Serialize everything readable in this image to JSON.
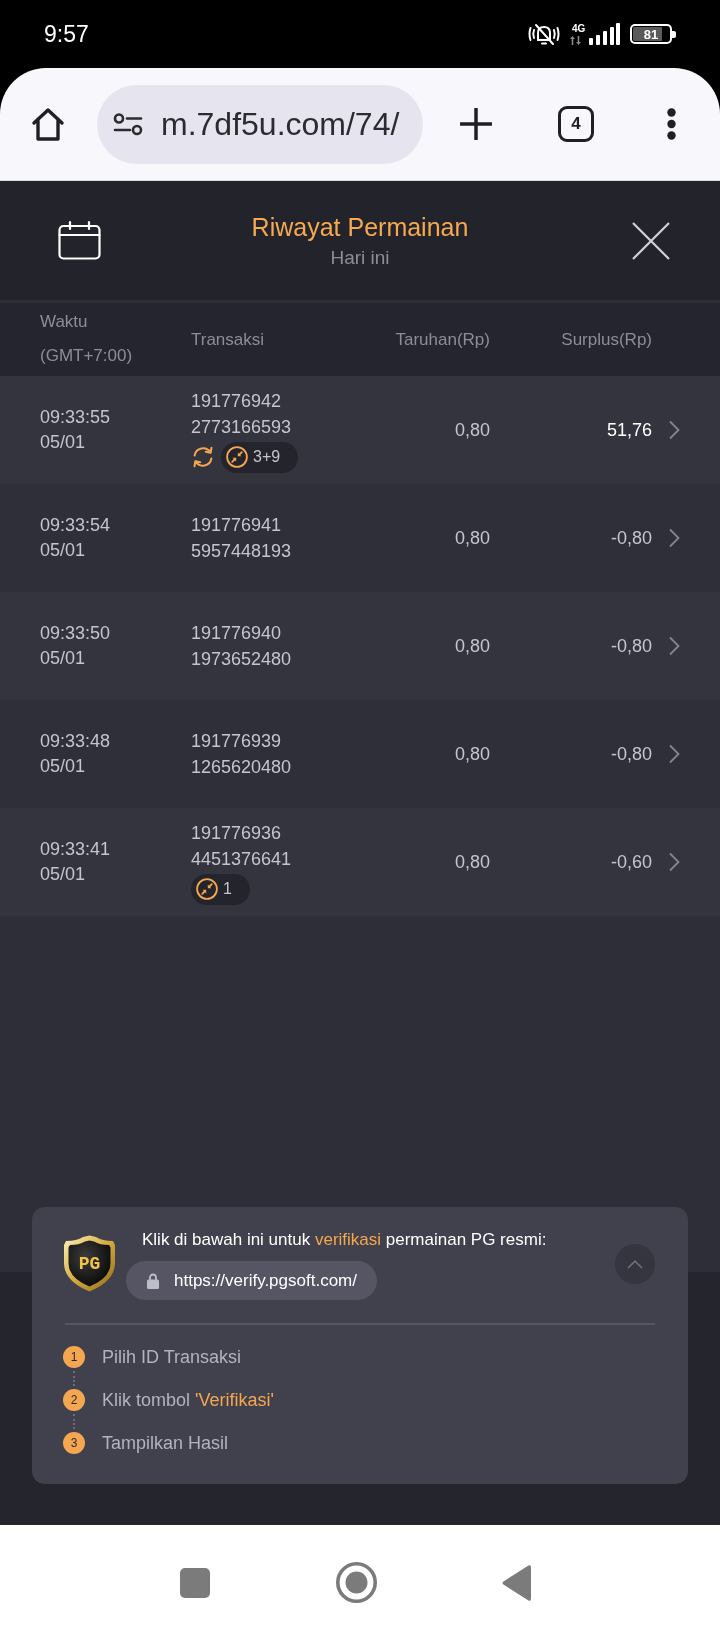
{
  "status_bar": {
    "time": "9:57",
    "network": "4G",
    "battery": "81"
  },
  "browser": {
    "url": "m.7df5u.com/74/",
    "tab_count": "4"
  },
  "header": {
    "title": "Riwayat Permainan",
    "subtitle": "Hari ini"
  },
  "table": {
    "columns": [
      {
        "label": "Waktu",
        "note": "(GMT+7:00)"
      },
      {
        "label": "Transaksi"
      },
      {
        "label": "Taruhan(Rp)"
      },
      {
        "label": "Surplus(Rp)"
      }
    ],
    "rows": [
      {
        "time": "09:33:55",
        "date": "05/01",
        "transaction": [
          "191776942",
          "2773166593"
        ],
        "badges": [
          {
            "kind": "refresh"
          },
          {
            "kind": "count",
            "count": "3+9"
          }
        ],
        "bet": "0,80",
        "surplus": "51,76",
        "positive": true
      },
      {
        "time": "09:33:54",
        "date": "05/01",
        "transaction": [
          "191776941",
          "5957448193"
        ],
        "bet": "0,80",
        "surplus": "-0,80",
        "positive": false
      },
      {
        "time": "09:33:50",
        "date": "05/01",
        "transaction": [
          "191776940",
          "1973652480"
        ],
        "bet": "0,80",
        "surplus": "-0,80",
        "positive": false
      },
      {
        "time": "09:33:48",
        "date": "05/01",
        "transaction": [
          "191776939",
          "1265620480"
        ],
        "bet": "0,80",
        "surplus": "-0,80",
        "positive": false
      },
      {
        "time": "09:33:41",
        "date": "05/01",
        "transaction": [
          "191776936",
          "4451376641"
        ],
        "badges": [
          {
            "kind": "count",
            "count": "1"
          }
        ],
        "bet": "0,80",
        "surplus": "-0,60",
        "positive": false
      }
    ]
  },
  "verification": {
    "logo": "PG",
    "headline": [
      {
        "text": "Klik di bawah ini untuk ",
        "highlight": false
      },
      {
        "text": "verifikasi",
        "highlight": true
      },
      {
        "text": " permainan PG resmi:",
        "highlight": false
      }
    ],
    "link": "https://verify.pgsoft.com/",
    "steps": [
      {
        "number": "1",
        "parts": [
          {
            "text": "Pilih ID Transaksi",
            "highlight": false
          }
        ]
      },
      {
        "number": "2",
        "parts": [
          {
            "text": "Klik tombol ",
            "highlight": false
          },
          {
            "text": "'Verifikasi'",
            "highlight": true
          }
        ]
      },
      {
        "number": "3",
        "parts": [
          {
            "text": "Tampilkan Hasil",
            "highlight": false
          }
        ]
      }
    ]
  }
}
